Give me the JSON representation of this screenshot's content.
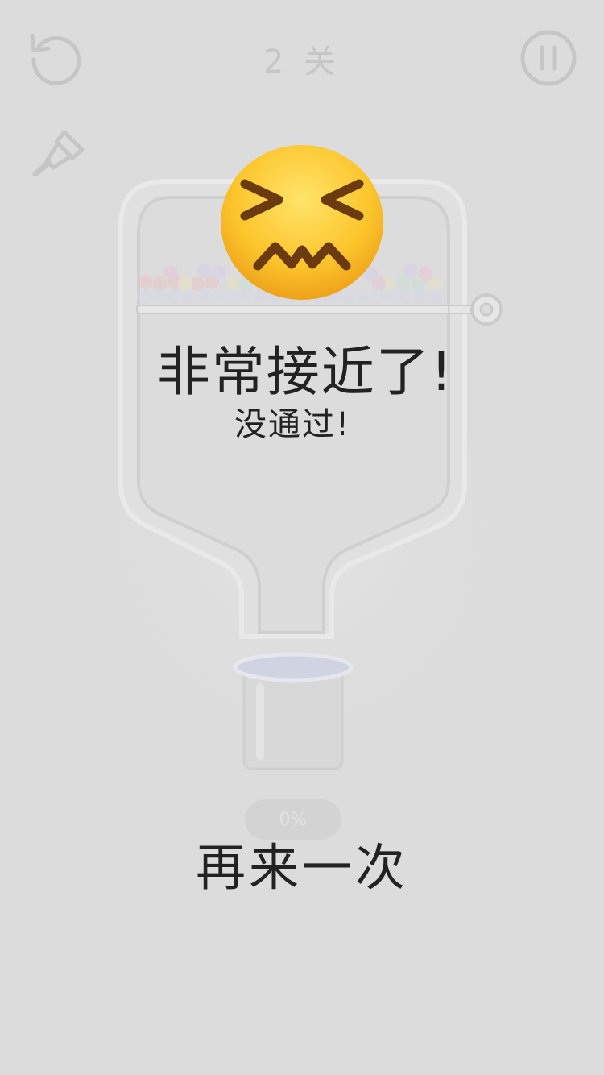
{
  "header": {
    "level_label": "2 关"
  },
  "progress": {
    "percent_label": "0%",
    "value": 0
  },
  "result": {
    "emoji": "confounded-face",
    "headline": "非常接近了!",
    "subline": "没通过!",
    "retry_label": "再来一次"
  },
  "icons": {
    "restart": "restart-icon",
    "pause": "pause-icon",
    "paint": "paintbrush-icon",
    "key": "key-icon"
  },
  "colors": {
    "background": "#dcdcdc",
    "text_dark": "#222222",
    "faded_ui": "#c6c6c6",
    "emoji_yellow": "#ffcc33"
  }
}
